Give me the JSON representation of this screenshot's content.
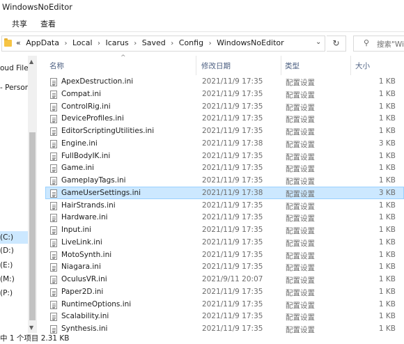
{
  "window": {
    "title": "WindowsNoEditor"
  },
  "ribbon": {
    "tabs": [
      "共享",
      "查看"
    ]
  },
  "address": {
    "breadcrumb": [
      "«",
      "AppData",
      "Local",
      "Icarus",
      "Saved",
      "Config",
      "WindowsNoEditor"
    ],
    "dropdown_glyph": "⌄",
    "refresh_glyph": "↻"
  },
  "search": {
    "placeholder": "搜索\"Wi",
    "icon_glyph": "⚲"
  },
  "navpane": {
    "items": [
      {
        "label": "oud File"
      },
      {
        "label": "- Person"
      },
      {
        "label": "(C:)"
      },
      {
        "label": "(D:)"
      },
      {
        "label": "(E:)"
      },
      {
        "label": "(M:)"
      },
      {
        "label": "(P:)"
      }
    ],
    "scroll_up": "▲",
    "scroll_down": "▼"
  },
  "columns": {
    "name": "名称",
    "date": "修改日期",
    "type": "类型",
    "size": "大小",
    "sort_glyph": "^"
  },
  "files": [
    {
      "name": "ApexDestruction.ini",
      "date": "2021/11/9 17:35",
      "type": "配置设置",
      "size": "1 KB"
    },
    {
      "name": "Compat.ini",
      "date": "2021/11/9 17:35",
      "type": "配置设置",
      "size": "1 KB"
    },
    {
      "name": "ControlRig.ini",
      "date": "2021/11/9 17:35",
      "type": "配置设置",
      "size": "1 KB"
    },
    {
      "name": "DeviceProfiles.ini",
      "date": "2021/11/9 17:35",
      "type": "配置设置",
      "size": "1 KB"
    },
    {
      "name": "EditorScriptingUtilities.ini",
      "date": "2021/11/9 17:35",
      "type": "配置设置",
      "size": "1 KB"
    },
    {
      "name": "Engine.ini",
      "date": "2021/11/9 17:38",
      "type": "配置设置",
      "size": "3 KB"
    },
    {
      "name": "FullBodyIK.ini",
      "date": "2021/11/9 17:35",
      "type": "配置设置",
      "size": "1 KB"
    },
    {
      "name": "Game.ini",
      "date": "2021/11/9 17:35",
      "type": "配置设置",
      "size": "1 KB"
    },
    {
      "name": "GameplayTags.ini",
      "date": "2021/11/9 17:35",
      "type": "配置设置",
      "size": "1 KB"
    },
    {
      "name": "GameUserSettings.ini",
      "date": "2021/11/9 17:38",
      "type": "配置设置",
      "size": "3 KB",
      "selected": true
    },
    {
      "name": "HairStrands.ini",
      "date": "2021/11/9 17:35",
      "type": "配置设置",
      "size": "1 KB"
    },
    {
      "name": "Hardware.ini",
      "date": "2021/11/9 17:35",
      "type": "配置设置",
      "size": "1 KB"
    },
    {
      "name": "Input.ini",
      "date": "2021/11/9 17:35",
      "type": "配置设置",
      "size": "1 KB"
    },
    {
      "name": "LiveLink.ini",
      "date": "2021/11/9 17:35",
      "type": "配置设置",
      "size": "1 KB"
    },
    {
      "name": "MotoSynth.ini",
      "date": "2021/11/9 17:35",
      "type": "配置设置",
      "size": "1 KB"
    },
    {
      "name": "Niagara.ini",
      "date": "2021/11/9 17:35",
      "type": "配置设置",
      "size": "1 KB"
    },
    {
      "name": "OculusVR.ini",
      "date": "2021/9/11 20:07",
      "type": "配置设置",
      "size": "1 KB"
    },
    {
      "name": "Paper2D.ini",
      "date": "2021/11/9 17:35",
      "type": "配置设置",
      "size": "1 KB"
    },
    {
      "name": "RuntimeOptions.ini",
      "date": "2021/11/9 17:35",
      "type": "配置设置",
      "size": "1 KB"
    },
    {
      "name": "Scalability.ini",
      "date": "2021/11/9 17:35",
      "type": "配置设置",
      "size": "1 KB"
    },
    {
      "name": "Synthesis.ini",
      "date": "2021/11/9 17:35",
      "type": "配置设置",
      "size": "1 KB"
    }
  ],
  "status": {
    "text": "中 1 个项目  2.31 KB"
  },
  "colors": {
    "selection_bg": "#cce8ff",
    "selection_border": "#99d1ff",
    "header_text": "#4d6082",
    "folder": "#f6c444"
  }
}
